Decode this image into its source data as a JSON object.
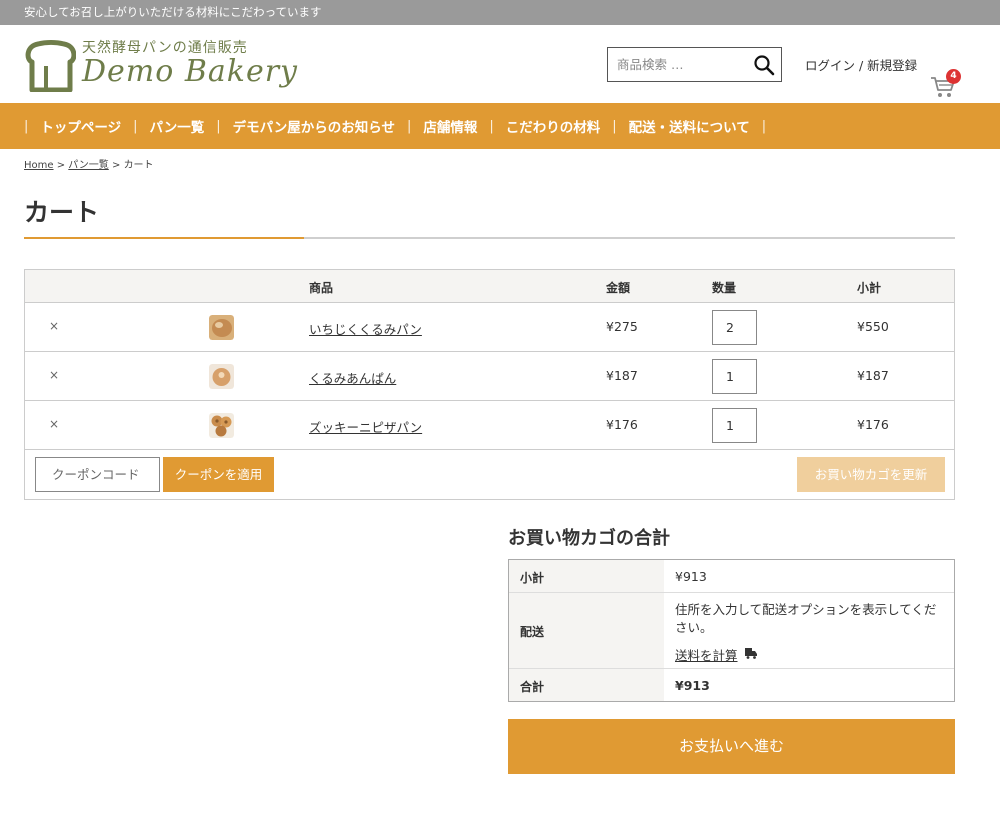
{
  "topbar": {
    "text": "安心してお召し上がりいただける材料にこだわっています"
  },
  "logo": {
    "subtitle": "天然酵母パンの通信販売",
    "title": "Demo Bakery"
  },
  "search": {
    "placeholder": "商品検索 …",
    "icon": "search-icon"
  },
  "account": {
    "login_label": "ログイン / 新規登録"
  },
  "cart": {
    "icon": "cart-icon",
    "count": "4"
  },
  "nav": {
    "items": [
      {
        "label": "トップページ"
      },
      {
        "label": "パン一覧"
      },
      {
        "label": "デモパン屋からのお知らせ"
      },
      {
        "label": "店舗情報"
      },
      {
        "label": "こだわりの材料"
      },
      {
        "label": "配送・送料について"
      }
    ],
    "separator": "|"
  },
  "breadcrumb": {
    "home": "Home",
    "list": "パン一覧",
    "current": "カート",
    "sep": ">"
  },
  "page": {
    "title": "カート"
  },
  "table": {
    "headers": {
      "product": "商品",
      "price": "金額",
      "qty": "数量",
      "subtotal": "小計"
    },
    "remove_symbol": "×",
    "rows": [
      {
        "name": "いちじくくるみパン",
        "price": "¥275",
        "qty": "2",
        "subtotal": "¥550"
      },
      {
        "name": "くるみあんぱん",
        "price": "¥187",
        "qty": "1",
        "subtotal": "¥187"
      },
      {
        "name": "ズッキーニピザパン",
        "price": "¥176",
        "qty": "1",
        "subtotal": "¥176"
      }
    ],
    "coupon_placeholder": "クーポンコード",
    "coupon_button": "クーポンを適用",
    "update_button": "お買い物カゴを更新"
  },
  "totals": {
    "title": "お買い物カゴの合計",
    "subtotal_label": "小計",
    "subtotal_value": "¥913",
    "shipping_label": "配送",
    "shipping_text": "住所を入力して配送オプションを表示してください。",
    "shipping_link": "送料を計算",
    "total_label": "合計",
    "total_value": "¥913"
  },
  "checkout": {
    "label": "お支払いへ進む"
  },
  "colors": {
    "accent": "#e09a33",
    "logo": "#6f7d4a",
    "topbar": "#9a9a9a",
    "badge": "#dd3333"
  }
}
